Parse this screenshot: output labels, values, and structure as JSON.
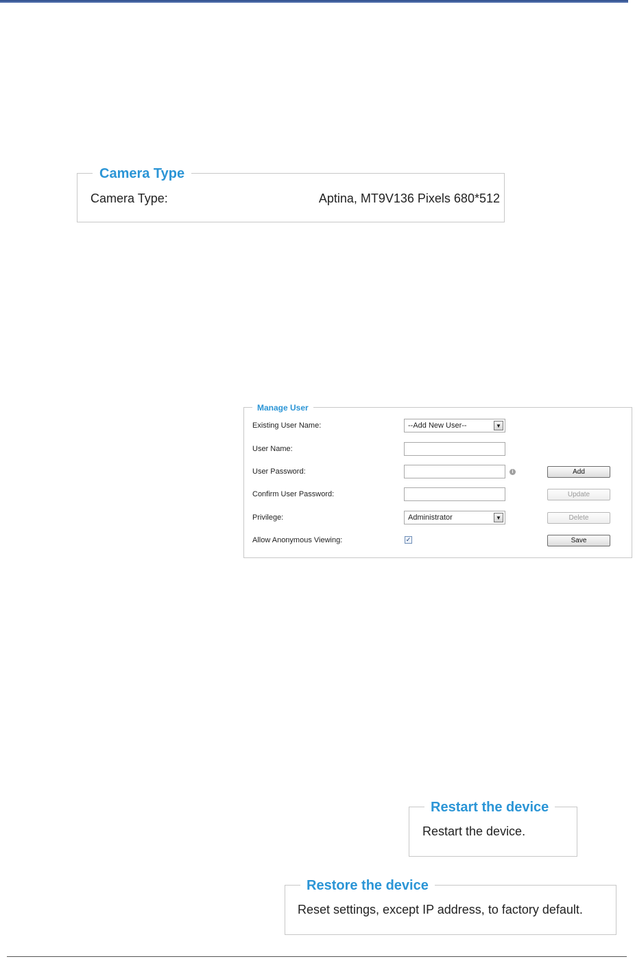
{
  "camera_type": {
    "legend": "Camera Type",
    "label": "Camera Type:",
    "value": "Aptina, MT9V136 Pixels 680*512"
  },
  "manage_user": {
    "legend": "Manage User",
    "existing_user_label": "Existing User Name:",
    "existing_user_value": "--Add New User--",
    "user_name_label": "User Name:",
    "user_name_value": "",
    "user_password_label": "User Password:",
    "user_password_value": "",
    "confirm_password_label": "Confirm User Password:",
    "confirm_password_value": "",
    "privilege_label": "Privilege:",
    "privilege_value": "Administrator",
    "anonymous_label": "Allow Anonymous Viewing:",
    "anonymous_checked": true,
    "buttons": {
      "add": "Add",
      "update": "Update",
      "delete": "Delete",
      "save": "Save"
    },
    "icons": {
      "dropdown": "chevron-down-icon",
      "info": "info-icon",
      "check": "check-icon"
    }
  },
  "restart": {
    "legend": "Restart the device",
    "text": "Restart the device."
  },
  "restore": {
    "legend": "Restore the device",
    "text": "Reset settings, except IP address, to factory default."
  },
  "colors": {
    "legend_blue": "#2b95d6",
    "header_rule": "#2e4d8a",
    "border": "#c8c8c8"
  }
}
